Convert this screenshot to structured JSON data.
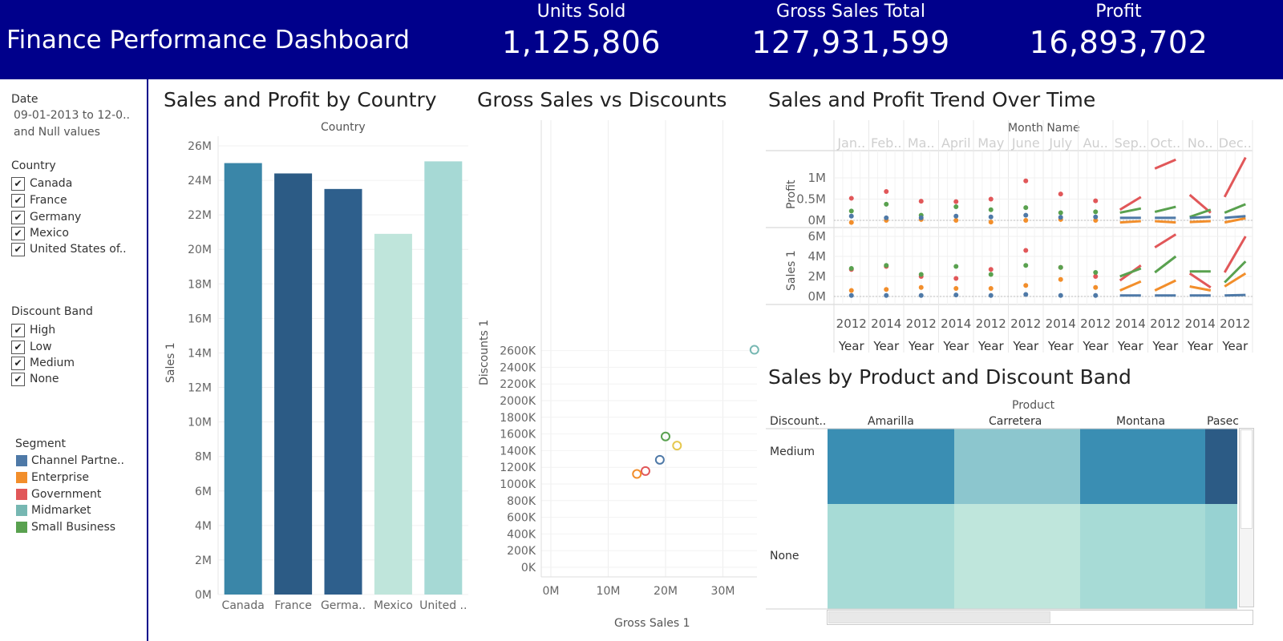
{
  "header": {
    "title": "Finance Performance Dashboard",
    "kpis": [
      {
        "label": "Units Sold",
        "value": "1,125,806"
      },
      {
        "label": "Gross Sales Total",
        "value": "127,931,599"
      },
      {
        "label": "Profit",
        "value": "16,893,702"
      }
    ]
  },
  "sidebar": {
    "date_title": "Date",
    "date_value": "09-01-2013 to 12-0..",
    "date_null": "and Null values",
    "country_title": "Country",
    "countries": [
      "Canada",
      "France",
      "Germany",
      "Mexico",
      "United States of.."
    ],
    "discount_title": "Discount Band",
    "discounts": [
      "High",
      "Low",
      "Medium",
      "None"
    ],
    "segment_title": "Segment",
    "segments": [
      {
        "label": "Channel Partne..",
        "color": "#4e79a7"
      },
      {
        "label": "Enterprise",
        "color": "#f28e2b"
      },
      {
        "label": "Government",
        "color": "#e15759"
      },
      {
        "label": "Midmarket",
        "color": "#76b7b2"
      },
      {
        "label": "Small Business",
        "color": "#59a14f"
      }
    ]
  },
  "bar_panel": {
    "title": "Sales and Profit by Country",
    "header": "Country",
    "ylabel": "Sales 1"
  },
  "scatter_panel": {
    "title": "Gross Sales vs Discounts",
    "xlabel": "Gross Sales 1",
    "ylabel": "Discounts 1"
  },
  "trend_panel": {
    "title": "Sales and Profit Trend Over Time",
    "header": "Month Name",
    "months": [
      "Jan..",
      "Feb..",
      "Ma..",
      "April",
      "May",
      "June",
      "July",
      "Au..",
      "Sep..",
      "Oct..",
      "No..",
      "Dec.."
    ],
    "years": [
      "2012",
      "2014",
      "2012",
      "2014",
      "2012",
      "2012",
      "2014",
      "2012",
      "2014",
      "2012",
      "2014",
      "2012"
    ],
    "year_label": "Year",
    "row_labels": [
      "Profit",
      "Sales 1"
    ],
    "profit_ticks": [
      "1M",
      "0.5M",
      "0M"
    ],
    "sales_ticks": [
      "6M",
      "4M",
      "2M",
      "0M"
    ]
  },
  "heat_panel": {
    "title": "Sales by Product and Discount Band",
    "header": "Product",
    "corner": "Discount..",
    "products": [
      "Amarilla",
      "Carretera",
      "Montana",
      "Pasec"
    ],
    "rows": [
      "Medium",
      "None"
    ]
  },
  "chart_data": [
    {
      "type": "bar",
      "title": "Sales and Profit by Country",
      "xlabel": "Country",
      "ylabel": "Sales 1",
      "categories": [
        "Canada",
        "France",
        "Germa..",
        "Mexico",
        "United .."
      ],
      "values": [
        25.0,
        24.4,
        23.5,
        20.9,
        25.1
      ],
      "colors": [
        "#3a86a8",
        "#2c5b85",
        "#2e5f8c",
        "#bfe5db",
        "#a6d9d5"
      ],
      "yticks": [
        "0M",
        "2M",
        "4M",
        "6M",
        "8M",
        "10M",
        "12M",
        "14M",
        "16M",
        "18M",
        "20M",
        "22M",
        "24M",
        "26M"
      ],
      "ylim": [
        0,
        26
      ],
      "grid": true
    },
    {
      "type": "scatter",
      "title": "Gross Sales vs Discounts",
      "xlabel": "Gross Sales 1",
      "ylabel": "Discounts 1",
      "xticks": [
        "0M",
        "10M",
        "20M",
        "30M"
      ],
      "yticks": [
        "0K",
        "200K",
        "400K",
        "600K",
        "800K",
        "1000K",
        "1200K",
        "1400K",
        "1600K",
        "1800K",
        "2000K",
        "2200K",
        "2400K",
        "2600K"
      ],
      "xlim": [
        0,
        36
      ],
      "ylim": [
        0,
        2600
      ],
      "points": [
        {
          "x": 35.5,
          "y": 2610,
          "color": "#76b7b2"
        },
        {
          "x": 20.0,
          "y": 1570,
          "color": "#59a14f"
        },
        {
          "x": 22.0,
          "y": 1460,
          "color": "#e6c84f"
        },
        {
          "x": 19.0,
          "y": 1290,
          "color": "#4e79a7"
        },
        {
          "x": 16.5,
          "y": 1155,
          "color": "#e15759"
        },
        {
          "x": 15.0,
          "y": 1120,
          "color": "#f28e2b"
        }
      ],
      "grid": true
    },
    {
      "type": "line",
      "title": "Sales and Profit Trend Over Time",
      "panels": [
        "Profit",
        "Sales 1"
      ],
      "series": [
        {
          "name": "Government",
          "color": "#e15759",
          "profit": [
            [
              0.52
            ],
            [
              0.68
            ],
            [
              0.45
            ],
            [
              0.44
            ],
            [
              0.5
            ],
            [
              0.93
            ],
            [
              0.62
            ],
            [
              0.46
            ],
            [
              0.25,
              0.55
            ],
            [
              1.22,
              1.43
            ],
            [
              0.6,
              0.18
            ],
            [
              0.55,
              1.48
            ]
          ],
          "sales": [
            [
              2.7
            ],
            [
              3.0
            ],
            [
              2.0
            ],
            [
              1.8
            ],
            [
              2.7
            ],
            [
              4.6
            ],
            [
              2.9
            ],
            [
              2.0
            ],
            [
              1.6,
              3.1
            ],
            [
              4.9,
              6.2
            ],
            [
              2.3,
              0.9
            ],
            [
              2.4,
              6.0
            ]
          ]
        },
        {
          "name": "Small Business",
          "color": "#59a14f",
          "profit": [
            [
              0.22
            ],
            [
              0.38
            ],
            [
              0.12
            ],
            [
              0.32
            ],
            [
              0.25
            ],
            [
              0.3
            ],
            [
              0.18
            ],
            [
              0.2
            ],
            [
              0.18,
              0.28
            ],
            [
              0.2,
              0.32
            ],
            [
              0.08,
              0.25
            ],
            [
              0.18,
              0.38
            ]
          ],
          "sales": [
            [
              2.8
            ],
            [
              3.1
            ],
            [
              2.2
            ],
            [
              3.0
            ],
            [
              2.2
            ],
            [
              3.1
            ],
            [
              2.9
            ],
            [
              2.4
            ],
            [
              2.0,
              2.8
            ],
            [
              2.4,
              4.0
            ],
            [
              2.5,
              2.5
            ],
            [
              1.4,
              3.5
            ]
          ]
        },
        {
          "name": "Enterprise",
          "color": "#f28e2b",
          "profit": [
            [
              -0.05
            ],
            [
              0.0
            ],
            [
              0.02
            ],
            [
              0.0
            ],
            [
              -0.04
            ],
            [
              0.0
            ],
            [
              0.02
            ],
            [
              0.0
            ],
            [
              -0.05,
              -0.02
            ],
            [
              -0.02,
              -0.05
            ],
            [
              -0.04,
              -0.02
            ],
            [
              -0.05,
              0.05
            ]
          ],
          "sales": [
            [
              0.6
            ],
            [
              0.7
            ],
            [
              0.9
            ],
            [
              0.8
            ],
            [
              0.8
            ],
            [
              1.1
            ],
            [
              1.7
            ],
            [
              0.9
            ],
            [
              0.6,
              1.5
            ],
            [
              0.6,
              1.6
            ],
            [
              1.0,
              0.6
            ],
            [
              1.0,
              2.3
            ]
          ]
        },
        {
          "name": "Channel Partners",
          "color": "#4e79a7",
          "profit": [
            [
              0.1
            ],
            [
              0.06
            ],
            [
              0.06
            ],
            [
              0.1
            ],
            [
              0.08
            ],
            [
              0.12
            ],
            [
              0.07
            ],
            [
              0.08
            ],
            [
              0.06,
              0.06
            ],
            [
              0.06,
              0.06
            ],
            [
              0.06,
              0.08
            ],
            [
              0.06,
              0.1
            ]
          ],
          "sales": [
            [
              0.1
            ],
            [
              0.1
            ],
            [
              0.1
            ],
            [
              0.15
            ],
            [
              0.1
            ],
            [
              0.2
            ],
            [
              0.1
            ],
            [
              0.1
            ],
            [
              0.1,
              0.1
            ],
            [
              0.1,
              0.1
            ],
            [
              0.1,
              0.1
            ],
            [
              0.1,
              0.15
            ]
          ]
        }
      ]
    },
    {
      "type": "heatmap",
      "title": "Sales by Product and Discount Band",
      "columns": [
        "Amarilla",
        "Carretera",
        "Montana",
        "Pasec"
      ],
      "rows": [
        "Medium",
        "None"
      ],
      "colors": [
        [
          "#3a8eb3",
          "#8cc6ce",
          "#3a8eb3",
          "#2c5b85"
        ],
        [
          "#a7dbd6",
          "#bfe6dc",
          "#a7dbd6",
          "#97d2d2"
        ]
      ]
    }
  ]
}
